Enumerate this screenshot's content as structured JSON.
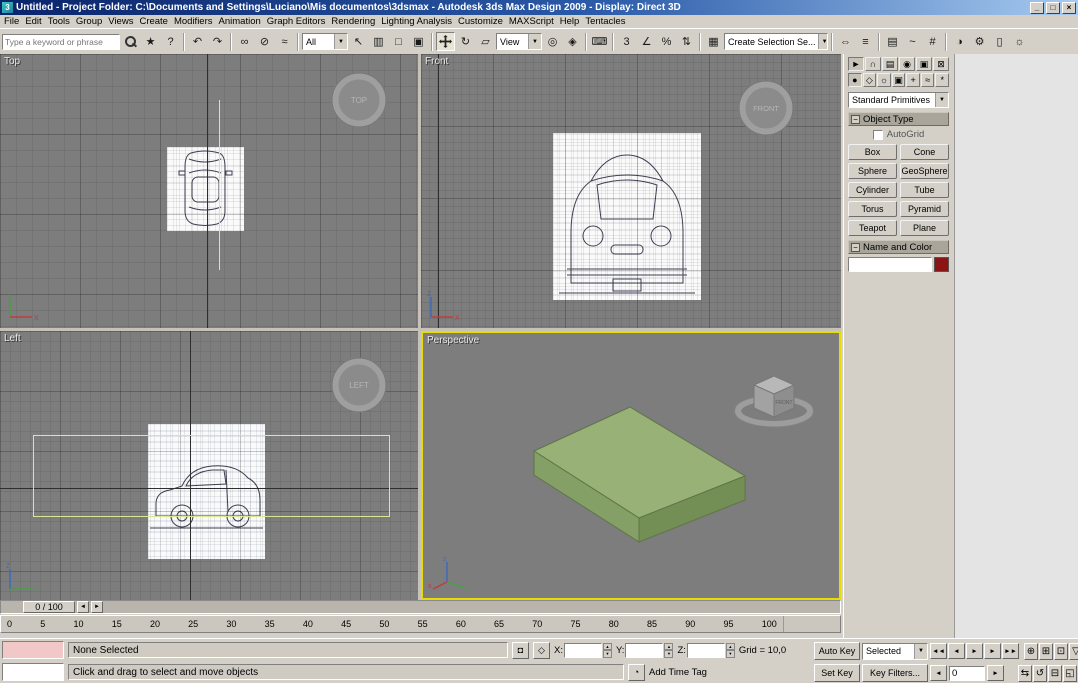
{
  "window": {
    "title": "Untitled - Project Folder: C:\\Documents and Settings\\Luciano\\Mis documentos\\3dsmax - Autodesk 3ds Max Design 2009 - Display: Direct 3D",
    "minimize": "_",
    "maximize": "□",
    "close": "×"
  },
  "menu": {
    "items": [
      "File",
      "Edit",
      "Tools",
      "Group",
      "Views",
      "Create",
      "Modifiers",
      "Animation",
      "Graph Editors",
      "Rendering",
      "Lighting Analysis",
      "Customize",
      "MAXScript",
      "Help",
      "Tentacles"
    ]
  },
  "infocenter": {
    "placeholder": "Type a keyword or phrase",
    "star": "★",
    "help": "?"
  },
  "toolbar": {
    "selection_filter": "All",
    "ref_coord": "View",
    "named_sel": "Create Selection Se...",
    "icons": {
      "undo": "↶",
      "redo": "↷",
      "select-link": "∞",
      "unlink": "⊘",
      "bind-spacewarp": "≈",
      "select-object": "↖",
      "select-by-name": "▥",
      "region": "□",
      "window-crossing": "▣",
      "rotate": "↻",
      "scale": "▱",
      "use-center": "◎",
      "manipulate": "◈",
      "keyboard-override": "⌨",
      "snap-3d": "3",
      "angle-snap": "∠",
      "percent-snap": "%",
      "spinner-snap": "⇅",
      "named-sets": "▦",
      "mirror": "⇔",
      "align": "≡",
      "layer-manager": "▤",
      "curve-editor": "~",
      "schematic-view": "#",
      "material-editor": "◑",
      "render-setup": "⚙",
      "render-frame": "▯",
      "quick-render": "☼"
    }
  },
  "viewports": {
    "top": {
      "label": "Top",
      "cube": "TOP"
    },
    "front": {
      "label": "Front",
      "cube": "FRONT"
    },
    "left": {
      "label": "Left",
      "cube": "LEFT"
    },
    "perspective": {
      "label": "Perspective",
      "cube": "FRONT"
    }
  },
  "panel": {
    "tabs": [
      {
        "name": "tab-create-icon",
        "glyph": "►"
      },
      {
        "name": "tab-modify-icon",
        "glyph": "∩"
      },
      {
        "name": "tab-hierarchy-icon",
        "glyph": "▤"
      },
      {
        "name": "tab-motion-icon",
        "glyph": "◉"
      },
      {
        "name": "tab-display-icon",
        "glyph": "▣"
      },
      {
        "name": "tab-utilities-icon",
        "glyph": "⊠"
      }
    ],
    "categories": [
      {
        "name": "category-geometry-icon",
        "glyph": "●"
      },
      {
        "name": "category-shapes-icon",
        "glyph": "◇"
      },
      {
        "name": "category-lights-icon",
        "glyph": "☼"
      },
      {
        "name": "category-cameras-icon",
        "glyph": "▣"
      },
      {
        "name": "category-helpers-icon",
        "glyph": "+"
      },
      {
        "name": "category-spacewarps-icon",
        "glyph": "≈"
      },
      {
        "name": "category-systems-icon",
        "glyph": "*"
      }
    ],
    "dropdown": "Standard Primitives",
    "object_type": "Object Type",
    "autogrid": "AutoGrid",
    "primitives": [
      "Box",
      "Cone",
      "Sphere",
      "GeoSphere",
      "Cylinder",
      "Tube",
      "Torus",
      "Pyramid",
      "Teapot",
      "Plane"
    ],
    "name_color": "Name and Color",
    "name_value": ""
  },
  "timeline": {
    "handle": "0 / 100",
    "arrow_left": "◄",
    "arrow_right": "►",
    "ticks": [
      "0",
      "5",
      "10",
      "15",
      "20",
      "25",
      "30",
      "35",
      "40",
      "45",
      "50",
      "55",
      "60",
      "65",
      "70",
      "75",
      "80",
      "85",
      "90",
      "95",
      "100"
    ]
  },
  "status": {
    "selection": "None Selected",
    "prompt": "Click and drag to select and move objects",
    "grid": "Grid = 10,0",
    "x": "X:",
    "y": "Y:",
    "z": "Z:",
    "x_val": "",
    "y_val": "",
    "z_val": "",
    "add_time_tag": "Add Time Tag",
    "icons": {
      "lock": "◘",
      "offset": "◇",
      "time_tag": "◔"
    }
  },
  "anim": {
    "auto_key": "Auto Key",
    "set_key": "Set Key",
    "selected": "Selected",
    "key_filters": "Key Filters...",
    "frame": "0",
    "key_prev": "◄",
    "key_next": "►",
    "playback": [
      {
        "name": "go-to-start-icon",
        "glyph": "◄◄"
      },
      {
        "name": "previous-frame-icon",
        "glyph": "◄"
      },
      {
        "name": "play-icon",
        "glyph": "►"
      },
      {
        "name": "next-frame-icon",
        "glyph": "►"
      },
      {
        "name": "go-to-end-icon",
        "glyph": "►►"
      }
    ]
  },
  "nav": {
    "row1": [
      {
        "name": "zoom-icon",
        "glyph": "⊕"
      },
      {
        "name": "zoom-all-icon",
        "glyph": "⊞"
      },
      {
        "name": "zoom-extents-icon",
        "glyph": "⊡"
      },
      {
        "name": "field-of-view-icon",
        "glyph": "▽"
      }
    ],
    "row2": [
      {
        "name": "pan-icon",
        "glyph": "⇆"
      },
      {
        "name": "arc-rotate-icon",
        "glyph": "↺"
      },
      {
        "name": "zoom-extents-all-icon",
        "glyph": "⊟"
      },
      {
        "name": "maximize-viewport-icon",
        "glyph": "◱"
      }
    ]
  },
  "colors": {
    "titlebar": "#0a246a",
    "active_viewport_border": "#e8dc00",
    "viewport_background": "#7d7d7d",
    "box_top": "#97b176",
    "box_front": "#85a066",
    "box_side": "#748f55",
    "name_swatch": "#8c1414",
    "selection_highlight": "#d6e992",
    "listener_pink": "#f2c7c7"
  }
}
